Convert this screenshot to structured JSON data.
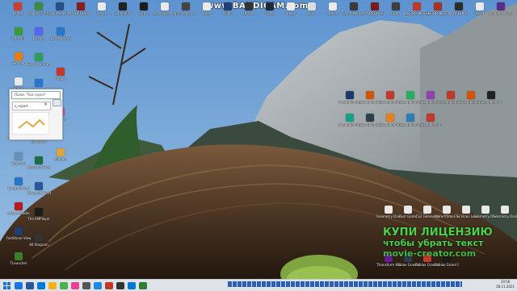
{
  "watermark": "www.BANDICAM.com",
  "icons_top": [
    {
      "label": "Kaiten",
      "color": "#d33b2b"
    },
    {
      "label": "Google Chrome",
      "color": "#3d8c3d"
    },
    {
      "label": "Counter-Strike",
      "color": "#2a4d8c"
    },
    {
      "label": "MORDHAU",
      "color": "#8a1c1c"
    },
    {
      "label": "Steam",
      "color": "#e9e9e9"
    },
    {
      "label": "Gameplay",
      "color": "#222"
    },
    {
      "label": "Game",
      "color": "#1b1b1b"
    },
    {
      "label": "Steam Desktop",
      "color": "#e9e9e9"
    },
    {
      "label": "screenshot",
      "color": "#444"
    },
    {
      "label": "Steam",
      "color": "#e9e9e9"
    },
    {
      "label": "Origin",
      "color": "#1f3f73"
    },
    {
      "label": "Ubisoft",
      "color": "#333"
    },
    {
      "label": "Game",
      "color": "#1e2a3a"
    },
    {
      "label": "Steam",
      "color": "#e9e9e9"
    },
    {
      "label": "Epic",
      "color": "#ddd"
    },
    {
      "label": "Steam",
      "color": "#e9e9e9"
    },
    {
      "label": "Game Monster",
      "color": "#3a3a3a"
    },
    {
      "label": "MORDHAU",
      "color": "#7a1a1a"
    },
    {
      "label": "Opera",
      "color": "#3e3e3e"
    },
    {
      "label": "ВЫЗОВ ЖЕРТВЕ",
      "color": "#c0392b"
    },
    {
      "label": "ВЫЗОВ ЖЕРТВЕ",
      "color": "#a93226"
    },
    {
      "label": "MORDHAU",
      "color": "#2c2c2c"
    },
    {
      "label": "Steam",
      "color": "#e9e9e9"
    },
    {
      "label": "Yandex Monster",
      "color": "#5a2a8c"
    }
  ],
  "icons_left": [
    {
      "label": "Utorrent",
      "color": "#3a9a3a"
    },
    {
      "label": "Blender",
      "color": "#e87d0d"
    },
    {
      "label": "Steam",
      "color": "#e9e9e9"
    },
    {
      "label": "Opera",
      "color": "#c0392b"
    },
    {
      "label": "Рабочий стол",
      "color": "#2a76c6"
    },
    {
      "label": "Корзина",
      "color": "#6a8fb7"
    },
    {
      "label": "Control Panel",
      "color": "#2a76c6"
    },
    {
      "label": "Adobe Reader",
      "color": "#b71c1c"
    },
    {
      "label": "FastStone Viewer",
      "color": "#1f3f73"
    },
    {
      "label": "TLauncher",
      "color": "#3e7d2a"
    }
  ],
  "icons_left2": [
    {
      "label": "Discord",
      "color": "#5865f2"
    },
    {
      "label": "Google Chrome",
      "color": "#2e9d55"
    },
    {
      "label": "Vegas Pro",
      "color": "#2a76c6"
    },
    {
      "label": "Steam",
      "color": "#e9e9e9"
    },
    {
      "label": "Kaspersky",
      "color": "#1e8c5a"
    },
    {
      "label": "Microsoft Excel",
      "color": "#1d6f42"
    },
    {
      "label": "Microsoft Word",
      "color": "#2b579a"
    },
    {
      "label": "The KMPlayer",
      "color": "#1b1b1b"
    },
    {
      "label": "4K Stogram",
      "color": "#333"
    }
  ],
  "icons_left3": [
    {
      "label": "DOWNLOAD",
      "color": "#2a76c6"
    },
    {
      "label": "Roblox",
      "color": "#c0392b"
    },
    {
      "label": "Games",
      "color": "#e84393"
    },
    {
      "label": "shaders",
      "color": "#d9a441"
    }
  ],
  "icons_mid": [
    {
      "label": "musapplaming",
      "color": "#1a3a6a"
    },
    {
      "label": "musapplaming",
      "color": "#d35400"
    },
    {
      "label": "musapplaming",
      "color": "#c0392b"
    },
    {
      "label": "musapplaming",
      "color": "#27ae60"
    },
    {
      "label": "musapplaming",
      "color": "#8e44ad"
    },
    {
      "label": "musapplaming",
      "color": "#c0392b"
    },
    {
      "label": "musapplaming",
      "color": "#d35400"
    },
    {
      "label": "musapplaming",
      "color": "#222"
    },
    {
      "label": "musapplaming",
      "color": "#16a085"
    },
    {
      "label": "musapplaming",
      "color": "#2c3e50"
    },
    {
      "label": "musapplaming",
      "color": "#e67e22"
    },
    {
      "label": "musapplaming",
      "color": "#2980b9"
    },
    {
      "label": "musapplaming",
      "color": "#c0392b"
    }
  ],
  "icons_bottomright": [
    {
      "label": "Geometry Dash 2.2",
      "color": "#e8e8e8"
    },
    {
      "label": "Rust Game",
      "color": "#e8e8e8"
    },
    {
      "label": "CS2 Geometry",
      "color": "#e8e8e8"
    },
    {
      "label": "Waterframe - Space",
      "color": "#e8e8e8"
    },
    {
      "label": "CS2 Brain Lock",
      "color": "#e8e8e8"
    },
    {
      "label": "Geometry Dash 2.1",
      "color": "#e8e8e8"
    },
    {
      "label": "Geometry Dash 2.0",
      "color": "#e8e8e8"
    },
    {
      "label": "Ttransform - Geometry",
      "color": "#6a1b9a"
    },
    {
      "label": "Roblox Grand Story 2 Oh",
      "color": "#2c3e50"
    },
    {
      "label": "Roblox Grand Story The",
      "color": "#c0392b"
    },
    {
      "label": "Roblox Grand Story Mode",
      "color": "#1b1b1b"
    }
  ],
  "search_panel": {
    "placeholder": "Поиск \"Test report\"",
    "row_text": "s_report"
  },
  "promo": {
    "line1": "КУПИ ЛИЦЕНЗИЮ",
    "line2": "чтобы убрать текст",
    "line3": "movie-creator.com"
  },
  "clock": {
    "time": "19:56",
    "date": "28.11.2021"
  },
  "taskbar_icons": [
    "#1b73e8",
    "#2b579a",
    "#0078d7",
    "#f2b01e",
    "#4caf50",
    "#e84393",
    "#555",
    "#1e88e5",
    "#c0392b",
    "#333",
    "#0078d7",
    "#2e7d32"
  ]
}
